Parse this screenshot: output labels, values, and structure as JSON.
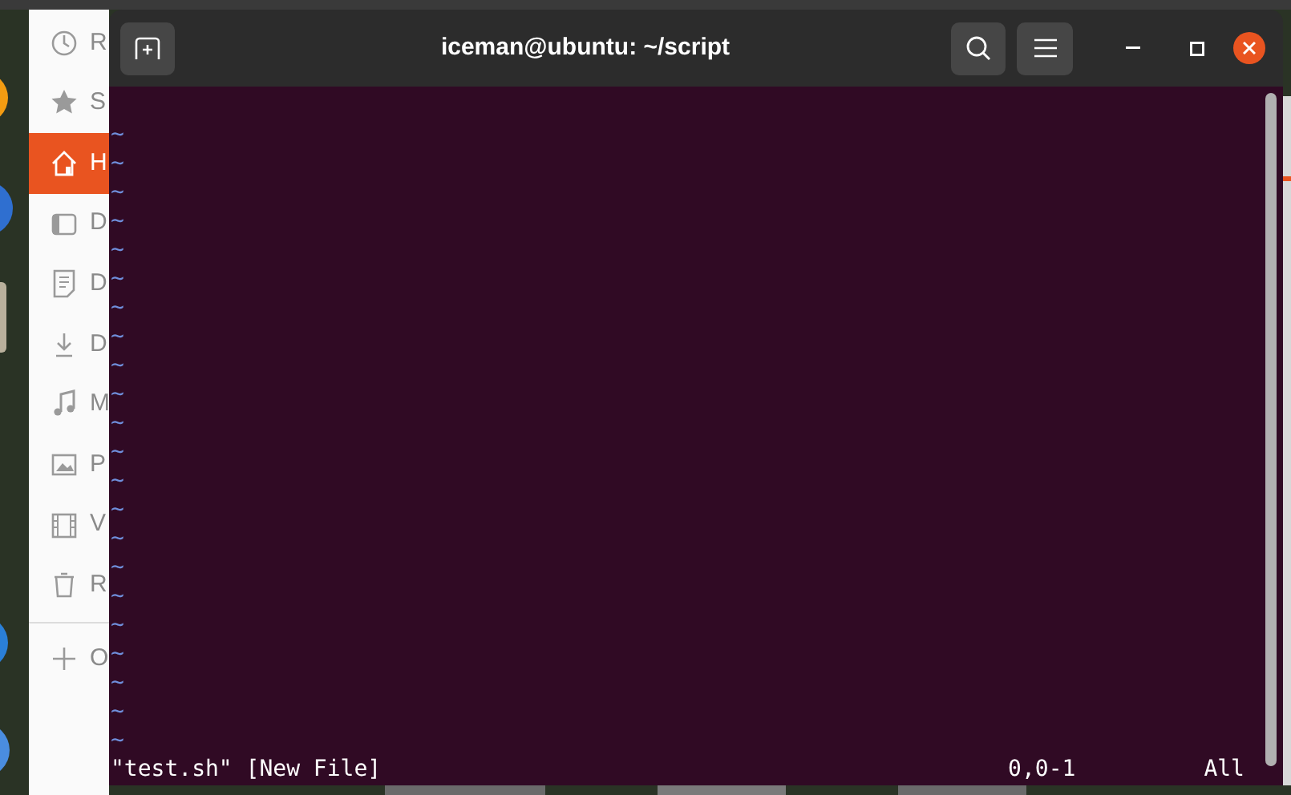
{
  "sidebar": {
    "items": [
      {
        "label": "R",
        "selected": false
      },
      {
        "label": "S",
        "selected": false
      },
      {
        "label": "H",
        "selected": true
      },
      {
        "label": "D",
        "selected": false
      },
      {
        "label": "D",
        "selected": false
      },
      {
        "label": "D",
        "selected": false
      },
      {
        "label": "M",
        "selected": false
      },
      {
        "label": "P",
        "selected": false
      },
      {
        "label": "V",
        "selected": false
      },
      {
        "label": "R",
        "selected": false
      }
    ],
    "other": {
      "label": "O"
    }
  },
  "window": {
    "title": "iceman@ubuntu: ~/script"
  },
  "editor": {
    "lines": [
      "~",
      "~",
      "~",
      "~",
      "~",
      "~",
      "~",
      "~",
      "~",
      "~",
      "~",
      "~",
      "~",
      "~",
      "~",
      "~",
      "~",
      "~",
      "~",
      "~",
      "~",
      "~"
    ],
    "status": {
      "message": "\"test.sh\" [New File]",
      "position": "0,0-1",
      "scroll": "All"
    }
  }
}
